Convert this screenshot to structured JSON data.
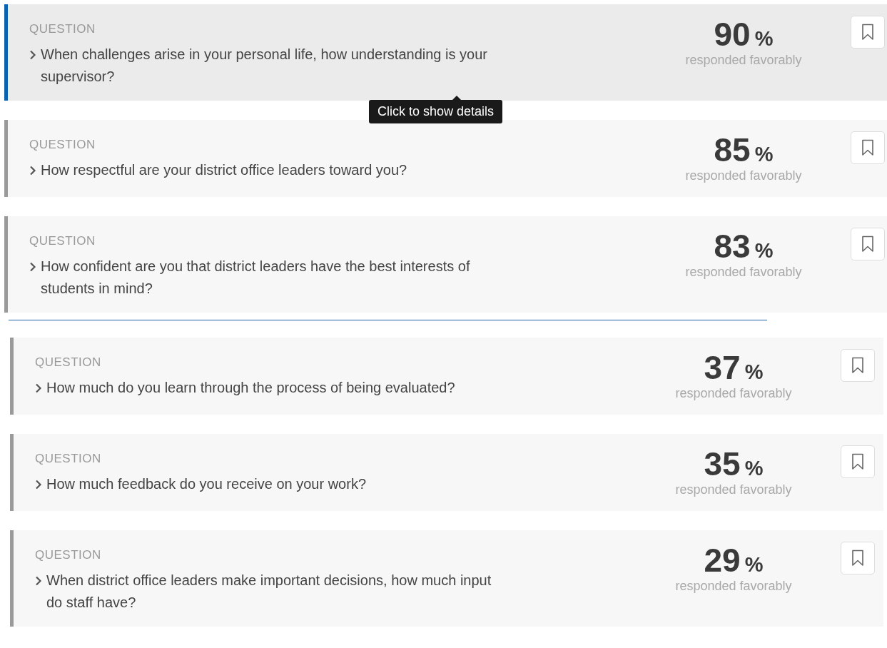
{
  "groups": [
    {
      "questions": [
        {
          "label": "QUESTION",
          "text": "When challenges arise in your personal life, how understanding is your supervisor?",
          "percent": "90",
          "percent_sign": "%",
          "caption": "responded favorably",
          "selected": true,
          "tooltip": "Click to show details"
        },
        {
          "label": "QUESTION",
          "text": "How respectful are your district office leaders toward you?",
          "percent": "85",
          "percent_sign": "%",
          "caption": "responded favorably",
          "selected": false
        },
        {
          "label": "QUESTION",
          "text": "How confident are you that district leaders have the best interests of students in mind?",
          "percent": "83",
          "percent_sign": "%",
          "caption": "responded favorably",
          "selected": false
        }
      ]
    },
    {
      "questions": [
        {
          "label": "QUESTION",
          "text": "How much do you learn through the process of being evaluated?",
          "percent": "37",
          "percent_sign": "%",
          "caption": "responded favorably",
          "selected": false
        },
        {
          "label": "QUESTION",
          "text": "How much feedback do you receive on your work?",
          "percent": "35",
          "percent_sign": "%",
          "caption": "responded favorably",
          "selected": false
        },
        {
          "label": "QUESTION",
          "text": "When district office leaders make important decisions, how much input do staff have?",
          "percent": "29",
          "percent_sign": "%",
          "caption": "responded favorably",
          "selected": false
        }
      ]
    }
  ]
}
